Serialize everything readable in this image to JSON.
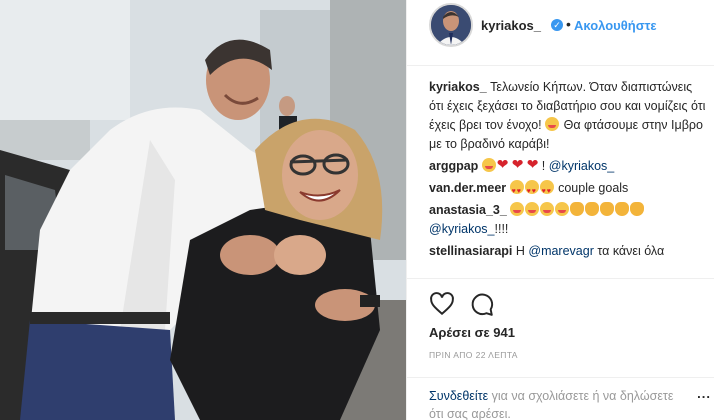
{
  "post": {
    "author": "kyriakos_",
    "follow_label": "Ακολουθήστε",
    "separator": "•",
    "verified_icon": "verified-badge-icon"
  },
  "caption": {
    "user": "kyriakos_",
    "text": "Τελωνείο Κήπων. Όταν διαπιστώνεις ότι έχεις ξεχάσει το διαβατήριο σου και νομίζεις ότι έχεις βρει τον ένοχο!",
    "text2": "Θα φτάσουμε στην Ιμβρο με το βραδινό καράβι!"
  },
  "comments": [
    {
      "user": "arggpap",
      "text": "!",
      "mention": "@kyriakos_"
    },
    {
      "user": "van.der.meer",
      "text": "couple goals"
    },
    {
      "user": "anastasia_3_",
      "mention": "@kyriakos_",
      "text": "!!!!"
    },
    {
      "user": "stellinasiarapi",
      "text_before": "Η",
      "mention": "@marevagr",
      "text": "τα κάνει όλα"
    }
  ],
  "actions": {
    "like_icon": "heart-icon",
    "comment_icon": "comment-icon",
    "likes": "Αρέσει σε 941",
    "time": "ΠΡΙΝ ΑΠΟ 22 ΛΕΠΤΑ"
  },
  "login": {
    "link": "Συνδεθείτε",
    "text": "για να σχολιάσετε ή να δηλώσετε ότι σας αρέσει.",
    "more": "..."
  },
  "colors": {
    "accent": "#3897f0",
    "mention": "#003569",
    "muted": "#999999"
  }
}
